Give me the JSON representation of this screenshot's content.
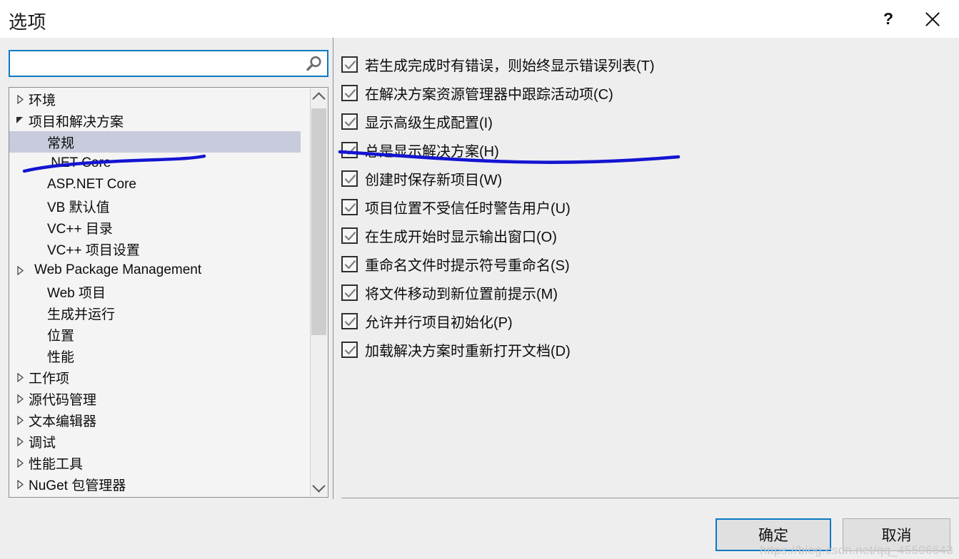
{
  "window": {
    "title": "选项",
    "help_icon": "question-mark-icon",
    "close_icon": "close-icon"
  },
  "search": {
    "value": "",
    "placeholder": "",
    "icon": "search-icon"
  },
  "tree": {
    "items": [
      {
        "label": "环境",
        "level": 1,
        "state": "collapsed",
        "selected": false
      },
      {
        "label": "项目和解决方案",
        "level": 1,
        "state": "expanded",
        "selected": false
      },
      {
        "label": "常规",
        "level": 2,
        "state": "leaf",
        "selected": true
      },
      {
        "label": ".NET Core",
        "level": 2,
        "state": "leaf",
        "selected": false
      },
      {
        "label": "ASP.NET Core",
        "level": 2,
        "state": "leaf",
        "selected": false
      },
      {
        "label": "VB 默认值",
        "level": 2,
        "state": "leaf",
        "selected": false
      },
      {
        "label": "VC++ 目录",
        "level": 2,
        "state": "leaf",
        "selected": false
      },
      {
        "label": "VC++ 项目设置",
        "level": 2,
        "state": "leaf",
        "selected": false
      },
      {
        "label": "Web Package Management",
        "level": 2,
        "state": "collapsed",
        "selected": false
      },
      {
        "label": "Web 项目",
        "level": 2,
        "state": "leaf",
        "selected": false
      },
      {
        "label": "生成并运行",
        "level": 2,
        "state": "leaf",
        "selected": false
      },
      {
        "label": "位置",
        "level": 2,
        "state": "leaf",
        "selected": false
      },
      {
        "label": "性能",
        "level": 2,
        "state": "leaf",
        "selected": false
      },
      {
        "label": "工作项",
        "level": 1,
        "state": "collapsed",
        "selected": false
      },
      {
        "label": "源代码管理",
        "level": 1,
        "state": "collapsed",
        "selected": false
      },
      {
        "label": "文本编辑器",
        "level": 1,
        "state": "collapsed",
        "selected": false
      },
      {
        "label": "调试",
        "level": 1,
        "state": "collapsed",
        "selected": false
      },
      {
        "label": "性能工具",
        "level": 1,
        "state": "collapsed",
        "selected": false
      },
      {
        "label": "NuGet 包管理器",
        "level": 1,
        "state": "collapsed",
        "selected": false
      }
    ],
    "scrollbar": {
      "up_icon": "chevron-up-icon",
      "down_icon": "chevron-down-icon"
    }
  },
  "options": {
    "checkboxes": [
      {
        "label": "若生成完成时有错误，则始终显示错误列表(T)",
        "checked": true
      },
      {
        "label": "在解决方案资源管理器中跟踪活动项(C)",
        "checked": true
      },
      {
        "label": "显示高级生成配置(I)",
        "checked": true
      },
      {
        "label": "总是显示解决方案(H)",
        "checked": true
      },
      {
        "label": "创建时保存新项目(W)",
        "checked": true
      },
      {
        "label": "项目位置不受信任时警告用户(U)",
        "checked": true
      },
      {
        "label": "在生成开始时显示输出窗口(O)",
        "checked": true
      },
      {
        "label": "重命名文件时提示符号重命名(S)",
        "checked": true
      },
      {
        "label": "将文件移动到新位置前提示(M)",
        "checked": true
      },
      {
        "label": "允许并行项目初始化(P)",
        "checked": true
      },
      {
        "label": "加载解决方案时重新打开文档(D)",
        "checked": true
      }
    ]
  },
  "footer": {
    "ok_label": "确定",
    "cancel_label": "取消"
  },
  "watermark": "https://blog.csdn.net/qq_45506643",
  "colors": {
    "accent_blue": "#0a7ac4",
    "annotation_blue": "#1414d2",
    "selection": "#c7cbdb",
    "dialog_bg": "#eeeeee",
    "tree_bg": "#f4f4f4"
  }
}
